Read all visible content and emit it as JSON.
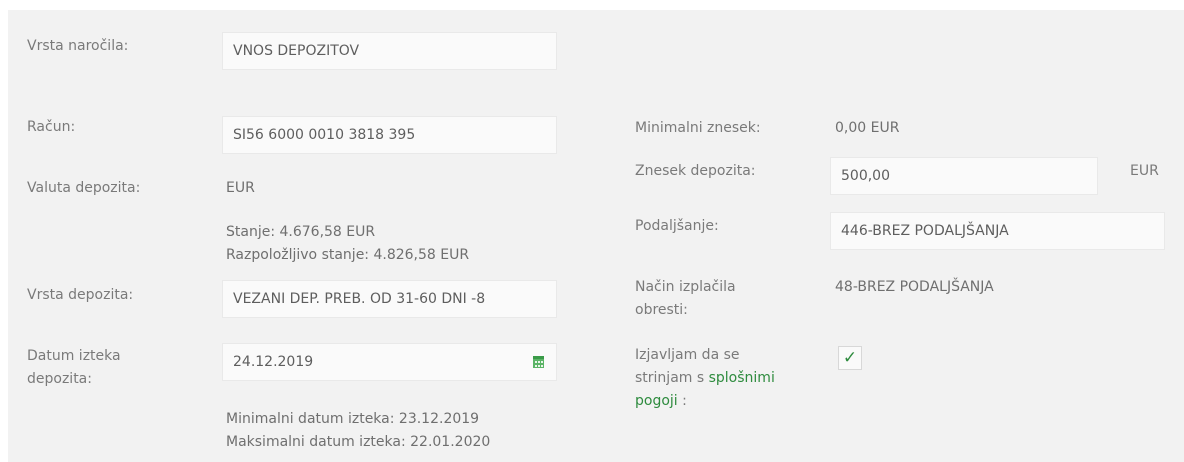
{
  "order_type": {
    "label": "Vrsta naročila:",
    "value": "VNOS DEPOZITOV"
  },
  "account": {
    "label": "Račun:",
    "value": "SI56 6000 0010 3818 395"
  },
  "currency": {
    "label": "Valuta depozita:",
    "value": "EUR"
  },
  "balance": {
    "text": "Stanje: 4.676,58 EUR",
    "available": "Razpoložljivo stanje: 4.826,58 EUR"
  },
  "deposit_type": {
    "label": "Vrsta depozita:",
    "value": "VEZANI DEP. PREB. OD 31-60 DNI -8"
  },
  "maturity": {
    "label_line1": "Datum izteka",
    "label_line2": "depozita:",
    "value": "24.12.2019",
    "icon": "calendar-icon",
    "min_text": "Minimalni datum izteka: 23.12.2019",
    "max_text": "Maksimalni datum izteka: 22.01.2020"
  },
  "min_amount": {
    "label": "Minimalni znesek:",
    "value": "0,00 EUR"
  },
  "deposit_amount": {
    "label": "Znesek depozita:",
    "value": "500,00",
    "unit": "EUR"
  },
  "extension": {
    "label": "Podaljšanje:",
    "value": "446-BREZ PODALJŠANJA"
  },
  "interest_payment": {
    "label_line1": "Način izplačila",
    "label_line2": "obresti:",
    "value": "48-BREZ PODALJŠANJA"
  },
  "agreement": {
    "line1": "Izjavljam da se",
    "line2_prefix": "strinjam s",
    "link_part1": "splošnimi",
    "link_part2": "pogoji",
    "suffix": " :",
    "checked": true,
    "check_glyph": "✓"
  },
  "colors": {
    "accent": "#2e8b3e",
    "panel": "#f2f2f2",
    "field": "#fafafa"
  }
}
